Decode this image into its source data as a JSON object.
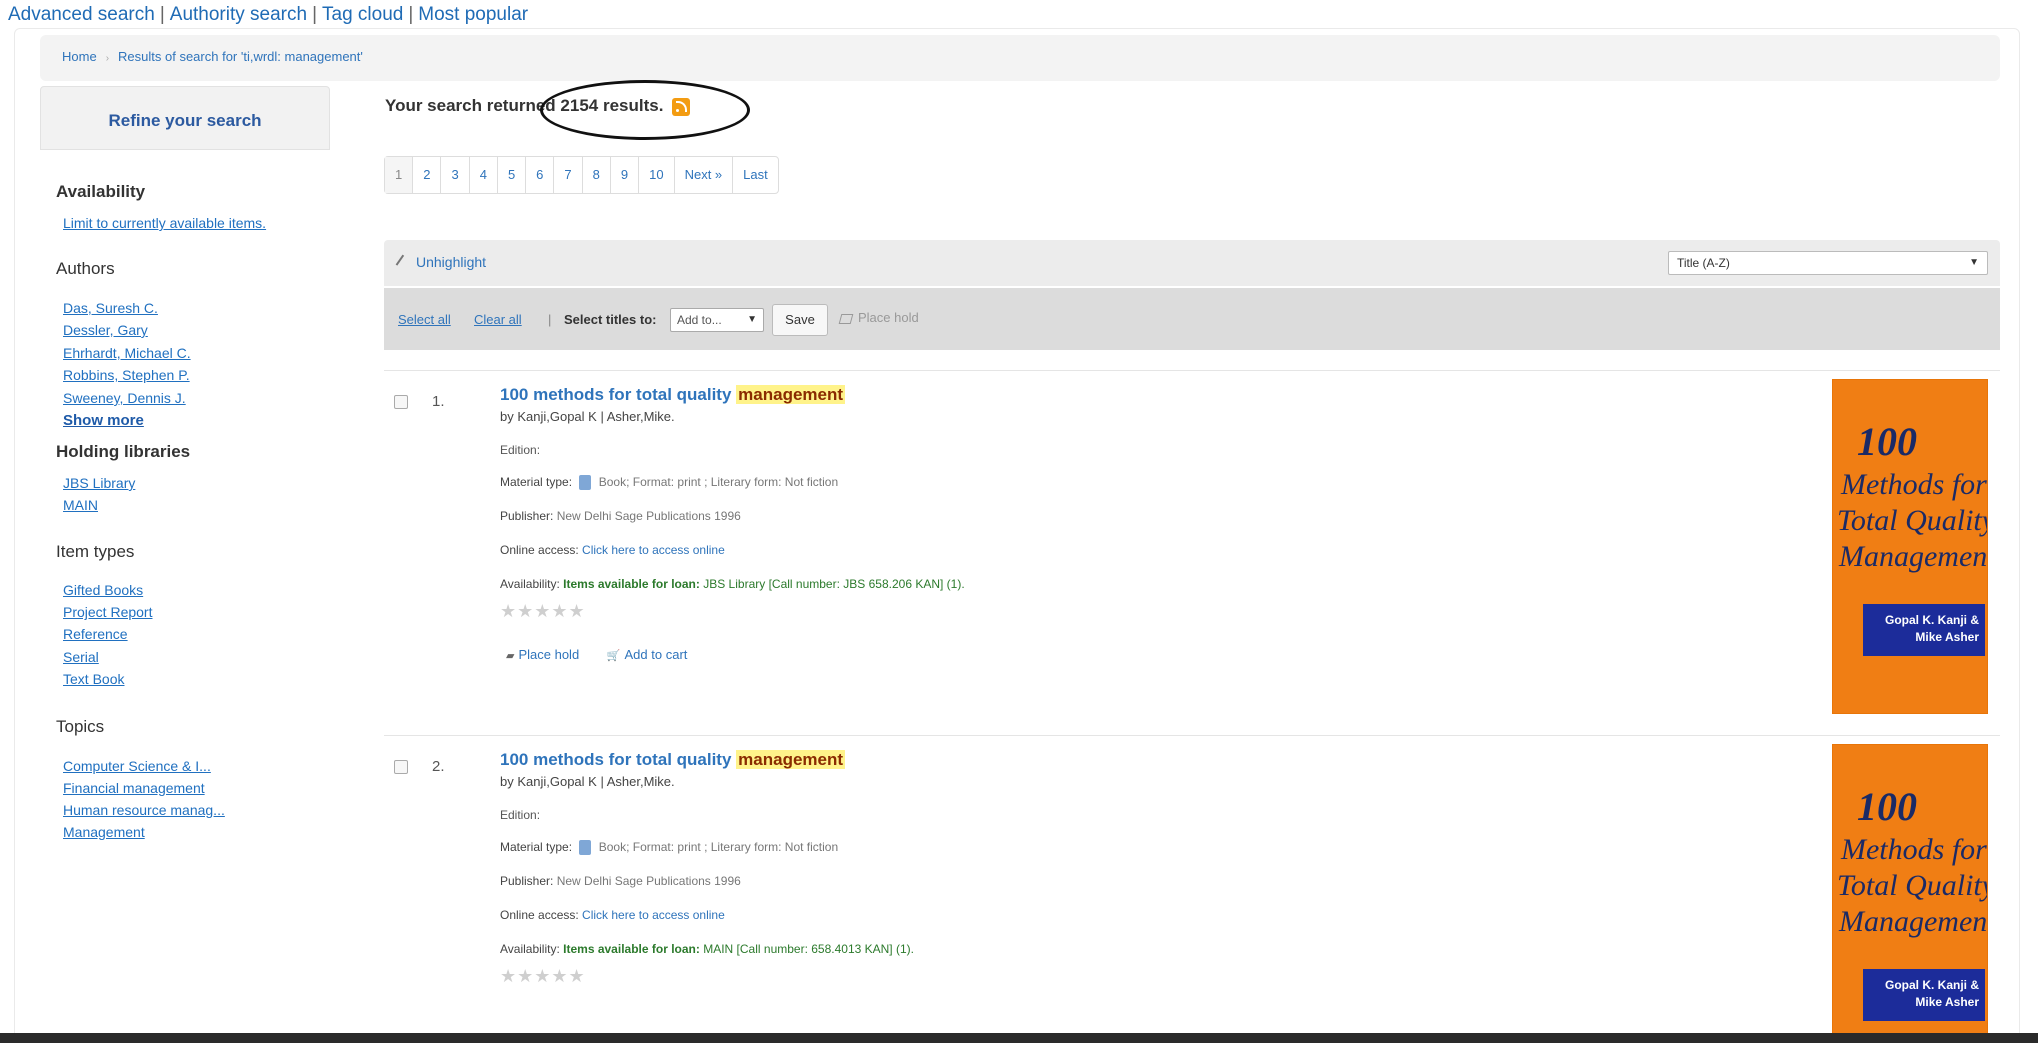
{
  "top_links": [
    "Advanced search",
    "Authority search",
    "Tag cloud",
    "Most popular"
  ],
  "breadcrumb": [
    "Home",
    "Results of search for 'ti,wrdl: management'"
  ],
  "sidebar": {
    "refine_title": "Refine your search",
    "availability": {
      "title": "Availability",
      "link": "Limit to currently available items."
    },
    "authors": {
      "title": "Authors",
      "items": [
        "Das, Suresh C.",
        "Dessler, Gary",
        "Ehrhardt, Michael C.",
        "Robbins, Stephen P.",
        "Sweeney, Dennis J."
      ],
      "show_more": "Show more"
    },
    "holding_libraries": {
      "title": "Holding libraries",
      "items": [
        "JBS Library",
        "MAIN"
      ]
    },
    "item_types": {
      "title": "Item types",
      "items": [
        "Gifted Books",
        "Project Report",
        "Reference",
        "Serial",
        "Text Book"
      ]
    },
    "topics": {
      "title": "Topics",
      "items": [
        "Computer Science & I...",
        "Financial management",
        "Human resource manag...",
        "Management"
      ]
    }
  },
  "results": {
    "count_prefix": "Your search returned",
    "count": "2154",
    "count_suffix": "results.",
    "pages": [
      "1",
      "2",
      "3",
      "4",
      "5",
      "6",
      "7",
      "8",
      "9",
      "10",
      "Next »",
      "Last"
    ]
  },
  "toolbar": {
    "unhighlight": "Unhighlight",
    "sort_value": "Title (A-Z)",
    "select_all": "Select all",
    "clear_all": "Clear all",
    "select_titles_label": "Select titles to:",
    "add_to": "Add to...",
    "save": "Save",
    "place_hold": "Place hold"
  },
  "records": [
    {
      "num": "1.",
      "title_pre": "100 methods for total quality",
      "title_hl": "management",
      "by": "by Kanji,Gopal K | Asher,Mike.",
      "edition": "Edition:",
      "material_label": "Material type:",
      "material_value": "Book; Format: print ; Literary form: Not fiction",
      "publisher_label": "Publisher:",
      "publisher_value": "New Delhi Sage Publications 1996",
      "online_label": "Online access:",
      "online_value": "Click here to access online",
      "avail_label": "Availability:",
      "avail_strong": "Items available for loan:",
      "avail_value": "JBS Library [Call number: JBS 658.206 KAN] (1).",
      "stars": "★★★★★",
      "action_hold": "Place hold",
      "action_cart": "Add to cart",
      "cover": {
        "num": "100",
        "l1": "Methods for",
        "l2": "Total Quality",
        "l3": "Management",
        "a1": "Gopal K. Kanji &",
        "a2": "Mike Asher"
      }
    },
    {
      "num": "2.",
      "title_pre": "100 methods for total quality",
      "title_hl": "management",
      "by": "by Kanji,Gopal K | Asher,Mike.",
      "edition": "Edition:",
      "material_label": "Material type:",
      "material_value": "Book; Format: print ; Literary form: Not fiction",
      "publisher_label": "Publisher:",
      "publisher_value": "New Delhi Sage Publications 1996",
      "online_label": "Online access:",
      "online_value": "Click here to access online",
      "avail_label": "Availability:",
      "avail_strong": "Items available for loan:",
      "avail_value": "MAIN [Call number: 658.4013 KAN] (1).",
      "stars": "★★★★★",
      "cover": {
        "num": "100",
        "l1": "Methods for",
        "l2": "Total Quality",
        "l3": "Management",
        "a1": "Gopal K. Kanji &",
        "a2": "Mike Asher"
      }
    }
  ]
}
